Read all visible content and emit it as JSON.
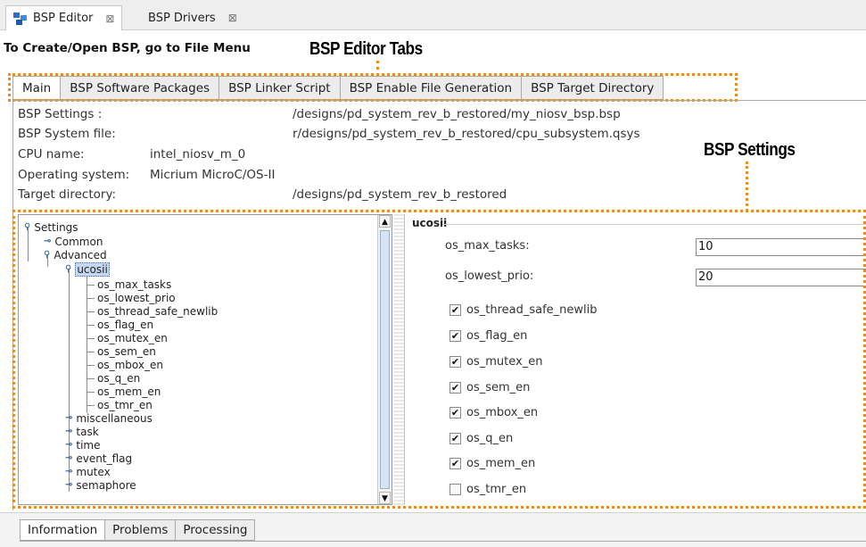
{
  "editor_tabs": [
    {
      "label": "BSP Editor",
      "close": "⊠",
      "icon": "bsp-editor-icon"
    },
    {
      "label": "BSP Drivers",
      "close": "⊠"
    }
  ],
  "instruction": "To Create/Open BSP, go to File Menu",
  "callouts": {
    "tabs": "BSP Editor Tabs",
    "settings": "BSP Settings"
  },
  "annotation_color": "#f08a1c",
  "sub_tabs": [
    "Main",
    "BSP Software Packages",
    "BSP Linker Script",
    "BSP Enable File Generation",
    "BSP Target Directory"
  ],
  "info": {
    "bsp_settings": {
      "label": "BSP Settings :",
      "value": "/designs/pd_system_rev_b_restored/my_niosv_bsp.bsp"
    },
    "bsp_system_file": {
      "label": "BSP System file:",
      "value": "r/designs/pd_system_rev_b_restored/cpu_subsystem.qsys"
    },
    "cpu_name": {
      "label": "CPU name:",
      "value": "intel_niosv_m_0"
    },
    "operating_system": {
      "label": "Operating system:",
      "value": "Micrium MicroC/OS-II"
    },
    "target_directory": {
      "label": "Target directory:",
      "value": "/designs/pd_system_rev_b_restored"
    }
  },
  "tree": {
    "root": "Settings",
    "common": "Common",
    "advanced": "Advanced",
    "ucosii": "ucosii",
    "leaves": [
      "os_max_tasks",
      "os_lowest_prio",
      "os_thread_safe_newlib",
      "os_flag_en",
      "os_mutex_en",
      "os_sem_en",
      "os_mbox_en",
      "os_q_en",
      "os_mem_en",
      "os_tmr_en"
    ],
    "groups": [
      "miscellaneous",
      "task",
      "time",
      "event_flag",
      "mutex",
      "semaphore"
    ]
  },
  "settings_pane": {
    "group_title": "ucosii",
    "fields": [
      {
        "label": "os_max_tasks:",
        "value": "10"
      },
      {
        "label": "os_lowest_prio:",
        "value": "20"
      }
    ],
    "checks": [
      {
        "label": "os_thread_safe_newlib",
        "checked": true
      },
      {
        "label": "os_flag_en",
        "checked": true
      },
      {
        "label": "os_mutex_en",
        "checked": true
      },
      {
        "label": "os_sem_en",
        "checked": true
      },
      {
        "label": "os_mbox_en",
        "checked": true
      },
      {
        "label": "os_q_en",
        "checked": true
      },
      {
        "label": "os_mem_en",
        "checked": true
      },
      {
        "label": "os_tmr_en",
        "checked": false
      }
    ],
    "check_mark": "✔"
  },
  "bottom_tabs": [
    "Information",
    "Problems",
    "Processing"
  ],
  "scroll_arrows": {
    "up": "▲",
    "down": "▼"
  }
}
